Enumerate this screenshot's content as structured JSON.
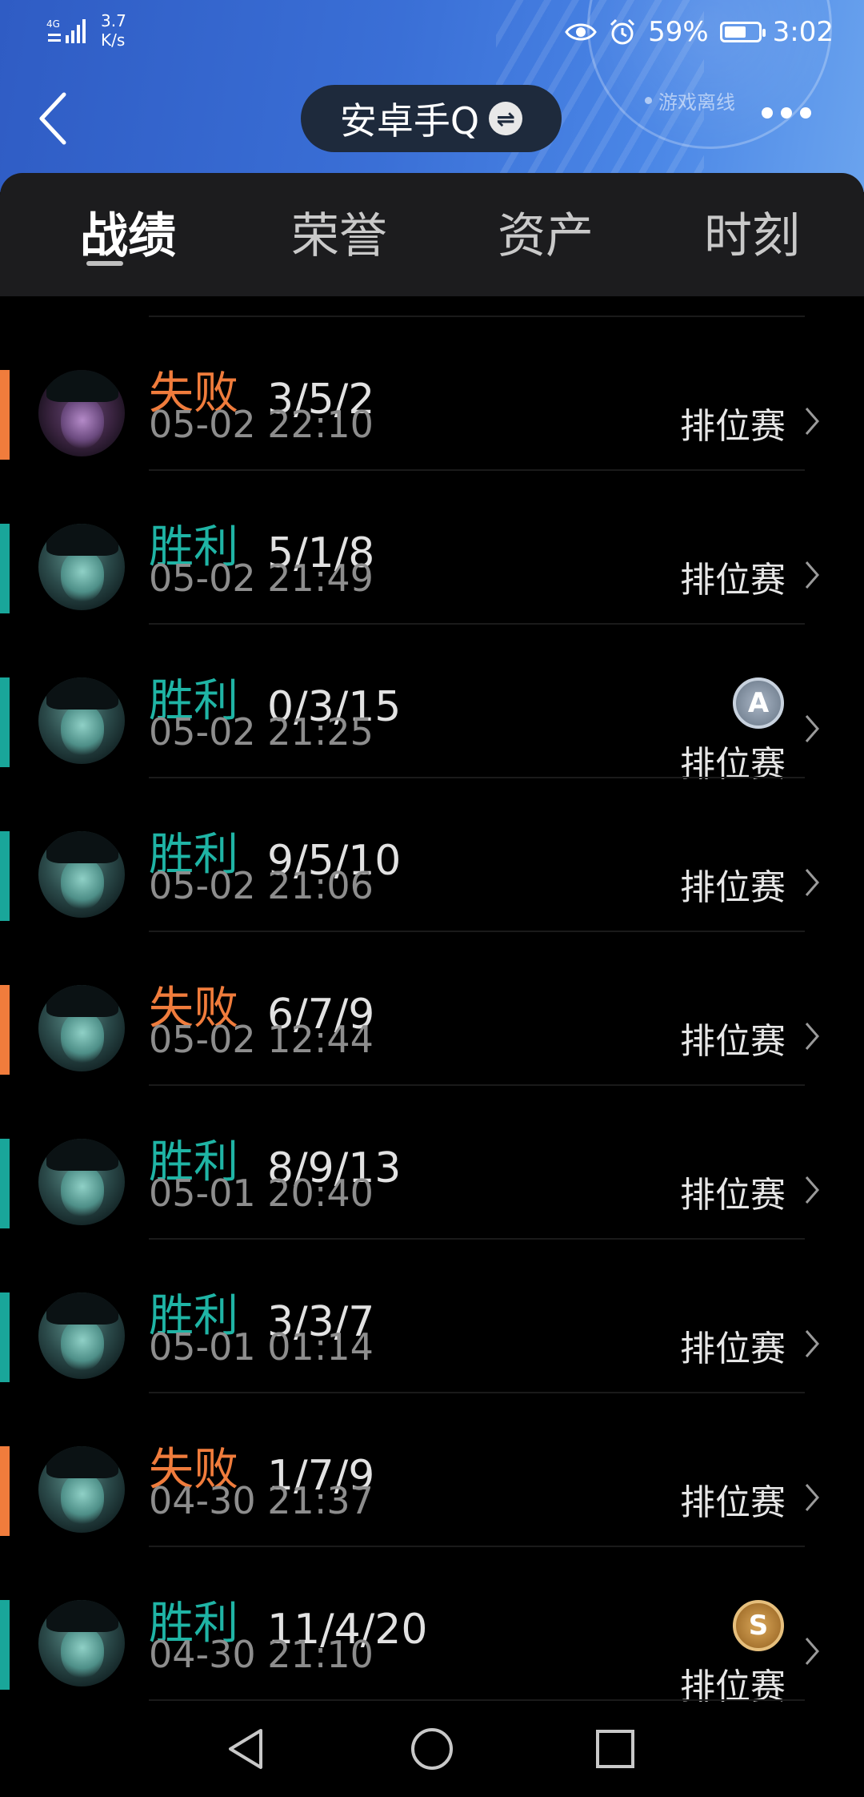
{
  "status_bar": {
    "network": "4G",
    "speed_value": "3.7",
    "speed_unit": "K/s",
    "battery": "59%",
    "time": "3:02"
  },
  "header": {
    "account_name": "安卓手Q",
    "status_text": "游戏离线",
    "icons": [
      "back-icon",
      "swap-icon",
      "more-icon"
    ]
  },
  "tabs": [
    {
      "label": "战绩",
      "active": true
    },
    {
      "label": "荣誉",
      "active": false
    },
    {
      "label": "资产",
      "active": false
    },
    {
      "label": "时刻",
      "active": false
    }
  ],
  "matches": [
    {
      "result": "失败",
      "kda": "3/5/2",
      "time": "05-02 22:10",
      "mode": "排位赛",
      "outcome": "loss",
      "badge": ""
    },
    {
      "result": "胜利",
      "kda": "5/1/8",
      "time": "05-02 21:49",
      "mode": "排位赛",
      "outcome": "win",
      "badge": ""
    },
    {
      "result": "胜利",
      "kda": "0/3/15",
      "time": "05-02 21:25",
      "mode": "排位赛",
      "outcome": "win",
      "badge": "A"
    },
    {
      "result": "胜利",
      "kda": "9/5/10",
      "time": "05-02 21:06",
      "mode": "排位赛",
      "outcome": "win",
      "badge": ""
    },
    {
      "result": "失败",
      "kda": "6/7/9",
      "time": "05-02 12:44",
      "mode": "排位赛",
      "outcome": "loss",
      "badge": ""
    },
    {
      "result": "胜利",
      "kda": "8/9/13",
      "time": "05-01 20:40",
      "mode": "排位赛",
      "outcome": "win",
      "badge": ""
    },
    {
      "result": "胜利",
      "kda": "3/3/7",
      "time": "05-01 01:14",
      "mode": "排位赛",
      "outcome": "win",
      "badge": ""
    },
    {
      "result": "失败",
      "kda": "1/7/9",
      "time": "04-30 21:37",
      "mode": "排位赛",
      "outcome": "loss",
      "badge": ""
    },
    {
      "result": "胜利",
      "kda": "11/4/20",
      "time": "04-30 21:10",
      "mode": "排位赛",
      "outcome": "win",
      "badge": "S"
    }
  ],
  "colors": {
    "win": "#1fb4a5",
    "loss": "#f07c3c",
    "header_blue": "#3a6fd6"
  }
}
